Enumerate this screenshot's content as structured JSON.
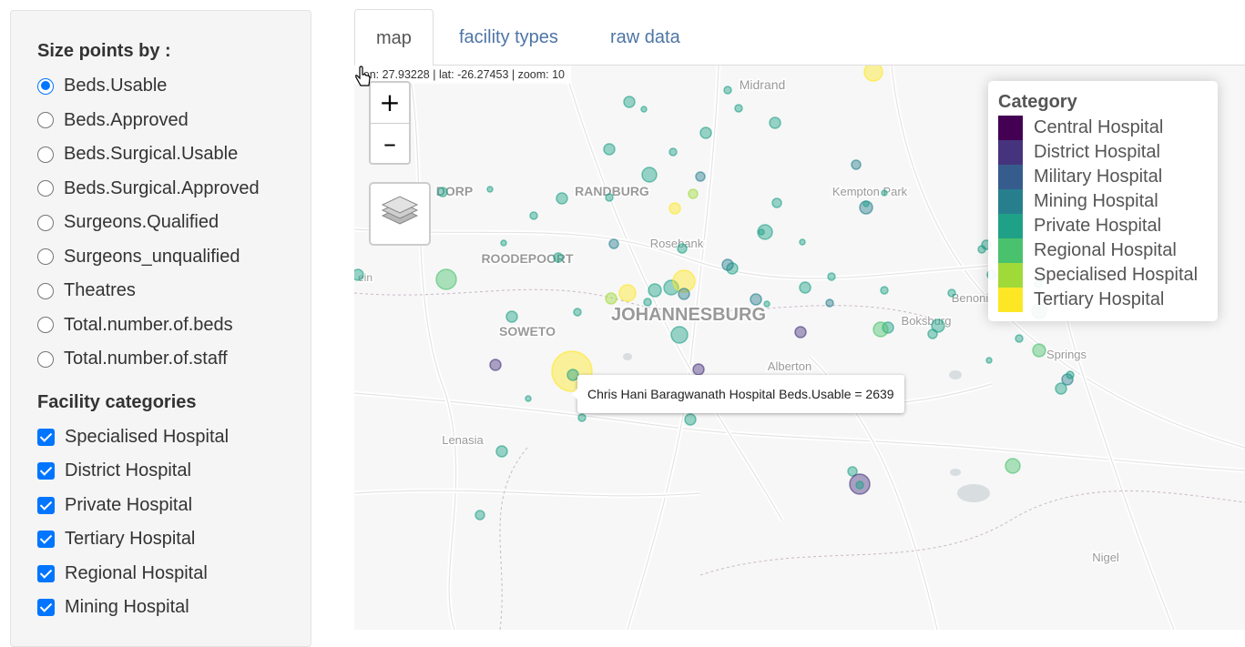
{
  "sidebar": {
    "size_title": "Size points by :",
    "size_options": [
      {
        "label": "Beds.Usable",
        "checked": true
      },
      {
        "label": "Beds.Approved",
        "checked": false
      },
      {
        "label": "Beds.Surgical.Usable",
        "checked": false
      },
      {
        "label": "Beds.Surgical.Approved",
        "checked": false
      },
      {
        "label": "Surgeons.Qualified",
        "checked": false
      },
      {
        "label": "Surgeons_unqualified",
        "checked": false
      },
      {
        "label": "Theatres",
        "checked": false
      },
      {
        "label": "Total.number.of.beds",
        "checked": false
      },
      {
        "label": "Total.number.of.staff",
        "checked": false
      }
    ],
    "categories_title": "Facility categories",
    "category_options": [
      {
        "label": "Specialised Hospital",
        "checked": true
      },
      {
        "label": "District Hospital",
        "checked": true
      },
      {
        "label": "Private Hospital",
        "checked": true
      },
      {
        "label": "Tertiary Hospital",
        "checked": true
      },
      {
        "label": "Regional Hospital",
        "checked": true
      },
      {
        "label": "Mining Hospital",
        "checked": true
      }
    ]
  },
  "tabs": [
    {
      "label": "map",
      "active": true
    },
    {
      "label": "facility types",
      "active": false
    },
    {
      "label": "raw data",
      "active": false
    }
  ],
  "map": {
    "coords": "lon: 27.93228 | lat: -26.27453 | zoom: 10",
    "zoom_in": "+",
    "zoom_out": "–",
    "places": [
      "Midrand",
      "RANDBURG",
      "Kempton Park",
      "Rosebank",
      "ROODEPOORT",
      "JOHANNESBURG",
      "SOWETO",
      "Benoni",
      "Boksburg",
      "Alberton",
      "Springs",
      "Lenasia",
      "Nigel",
      "DORP",
      "ein"
    ],
    "tooltip": "Chris Hani Baragwanath Hospital Beds.Usable = 2639"
  },
  "legend": {
    "title": "Category",
    "items": [
      {
        "label": "Central Hospital",
        "color": "#440154"
      },
      {
        "label": "District Hospital",
        "color": "#46337e"
      },
      {
        "label": "Military Hospital",
        "color": "#365c8d"
      },
      {
        "label": "Mining Hospital",
        "color": "#277f8e"
      },
      {
        "label": "Private Hospital",
        "color": "#1fa187"
      },
      {
        "label": "Regional Hospital",
        "color": "#4ac16d"
      },
      {
        "label": "Specialised Hospital",
        "color": "#a0da39"
      },
      {
        "label": "Tertiary Hospital",
        "color": "#fde725"
      }
    ]
  }
}
